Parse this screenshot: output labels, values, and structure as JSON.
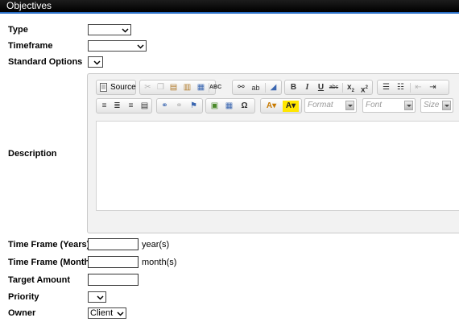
{
  "header": {
    "title": "Objectives"
  },
  "fields": {
    "type": {
      "label": "Type",
      "value": ""
    },
    "timeframe": {
      "label": "Timeframe",
      "value": ""
    },
    "standard_options": {
      "label": "Standard Options",
      "value": ""
    },
    "description": {
      "label": "Description"
    },
    "time_frame_years": {
      "label": "Time Frame (Years)",
      "value": "",
      "unit": "year(s)"
    },
    "time_frame_months": {
      "label": "Time Frame (Months)",
      "value": "",
      "unit": "month(s)"
    },
    "target_amount": {
      "label": "Target Amount",
      "value": ""
    },
    "priority": {
      "label": "Priority",
      "value": ""
    },
    "owner": {
      "label": "Owner",
      "value": "Client"
    }
  },
  "editor": {
    "source_label": "Source",
    "format_placeholder": "Format",
    "font_placeholder": "Font",
    "size_placeholder": "Size",
    "toolbar_icons_row1": [
      "cut-icon",
      "copy-icon",
      "paste-icon",
      "paste-text-icon",
      "paste-word-icon",
      "spellcheck-icon",
      "find-icon",
      "replace-icon",
      "eraser-icon",
      "bold-icon",
      "italic-icon",
      "underline-icon",
      "strikethrough-icon",
      "subscript-icon",
      "superscript-icon",
      "numbered-list-icon",
      "bulleted-list-icon",
      "outdent-icon",
      "indent-icon"
    ],
    "toolbar_icons_row2": [
      "align-left-icon",
      "align-center-icon",
      "align-right-icon",
      "justify-icon",
      "link-icon",
      "unlink-icon",
      "anchor-icon",
      "image-icon",
      "table-icon",
      "special-char-icon",
      "text-color-icon",
      "background-color-icon"
    ]
  }
}
